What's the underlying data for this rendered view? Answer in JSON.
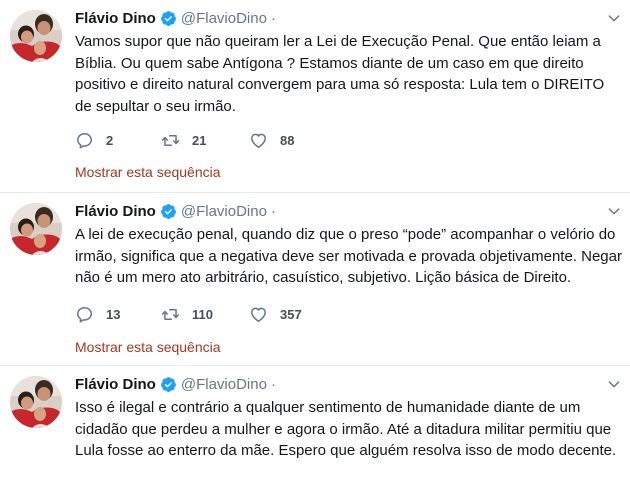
{
  "tweets": [
    {
      "author_name": "Flávio Dino",
      "handle": "@FlavioDino",
      "separator": "·",
      "text": "Vamos supor que não queiram ler a Lei de Execução Penal. Que então leiam a Bíblia. Ou quem sabe Antígona ? Estamos diante de um caso em que direito positivo e direito natural convergem para uma só resposta: Lula tem o DIREITO de sepultar o seu irmão.",
      "replies": "2",
      "retweets": "21",
      "likes": "88",
      "show_thread": "Mostrar esta sequência"
    },
    {
      "author_name": "Flávio Dino",
      "handle": "@FlavioDino",
      "separator": "·",
      "text": "A lei de execução penal, quando diz que o preso “pode” acompanhar o velório do irmão, significa que a negativa deve ser motivada e provada objetivamente. Negar não é um mero ato arbitrário, casuístico, subjetivo. Lição básica de Direito.",
      "replies": "13",
      "retweets": "110",
      "likes": "357",
      "show_thread": "Mostrar esta sequência"
    },
    {
      "author_name": "Flávio Dino",
      "handle": "@FlavioDino",
      "separator": "·",
      "text": "Isso é ilegal e contrário a qualquer sentimento de humanidade diante de um cidadão que perdeu a mulher e agora o irmão. Até a ditadura militar permitiu que Lula fosse ao enterro da mãe. Espero que alguém resolva isso de modo decente."
    }
  ],
  "colors": {
    "verified": "#1da1f2",
    "link": "#a3381e",
    "muted": "#657786",
    "divider": "#e6ecf0"
  },
  "icons": [
    "reply-icon",
    "retweet-icon",
    "like-icon",
    "verified-badge-icon",
    "chevron-down-icon"
  ]
}
